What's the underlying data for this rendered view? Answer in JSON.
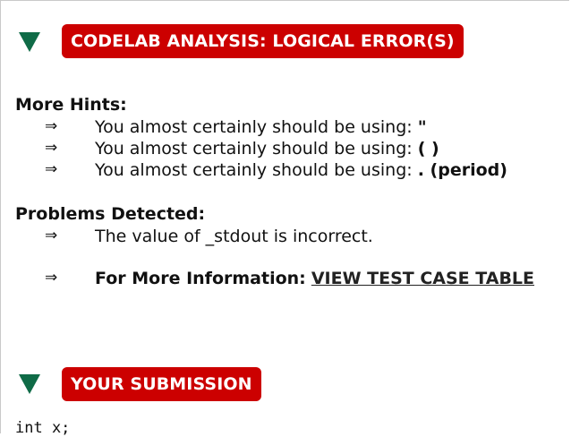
{
  "analysis": {
    "banner": "CODELAB ANALYSIS: LOGICAL ERROR(S)"
  },
  "hints": {
    "heading": "More Hints:",
    "arrow_glyph": "⇒",
    "items": [
      {
        "prefix": "You almost certainly should be using: ",
        "code": "\""
      },
      {
        "prefix": "You almost certainly should be using: ",
        "code": "( )"
      },
      {
        "prefix": "You almost certainly should be using: ",
        "code": ". (period)"
      }
    ]
  },
  "problems": {
    "heading": "Problems Detected:",
    "items": [
      {
        "text": "The value of _stdout is incorrect."
      }
    ],
    "more_info_label": "For More Information:",
    "more_info_link": "VIEW TEST CASE TABLE"
  },
  "submission": {
    "banner": "YOUR SUBMISSION",
    "code_line": "int x;"
  },
  "colors": {
    "banner_red": "#cc0000",
    "triangle_green": "#0f6b47"
  },
  "icons": {
    "collapse": "triangle-down-icon",
    "arrow": "double-right-arrow-icon"
  }
}
